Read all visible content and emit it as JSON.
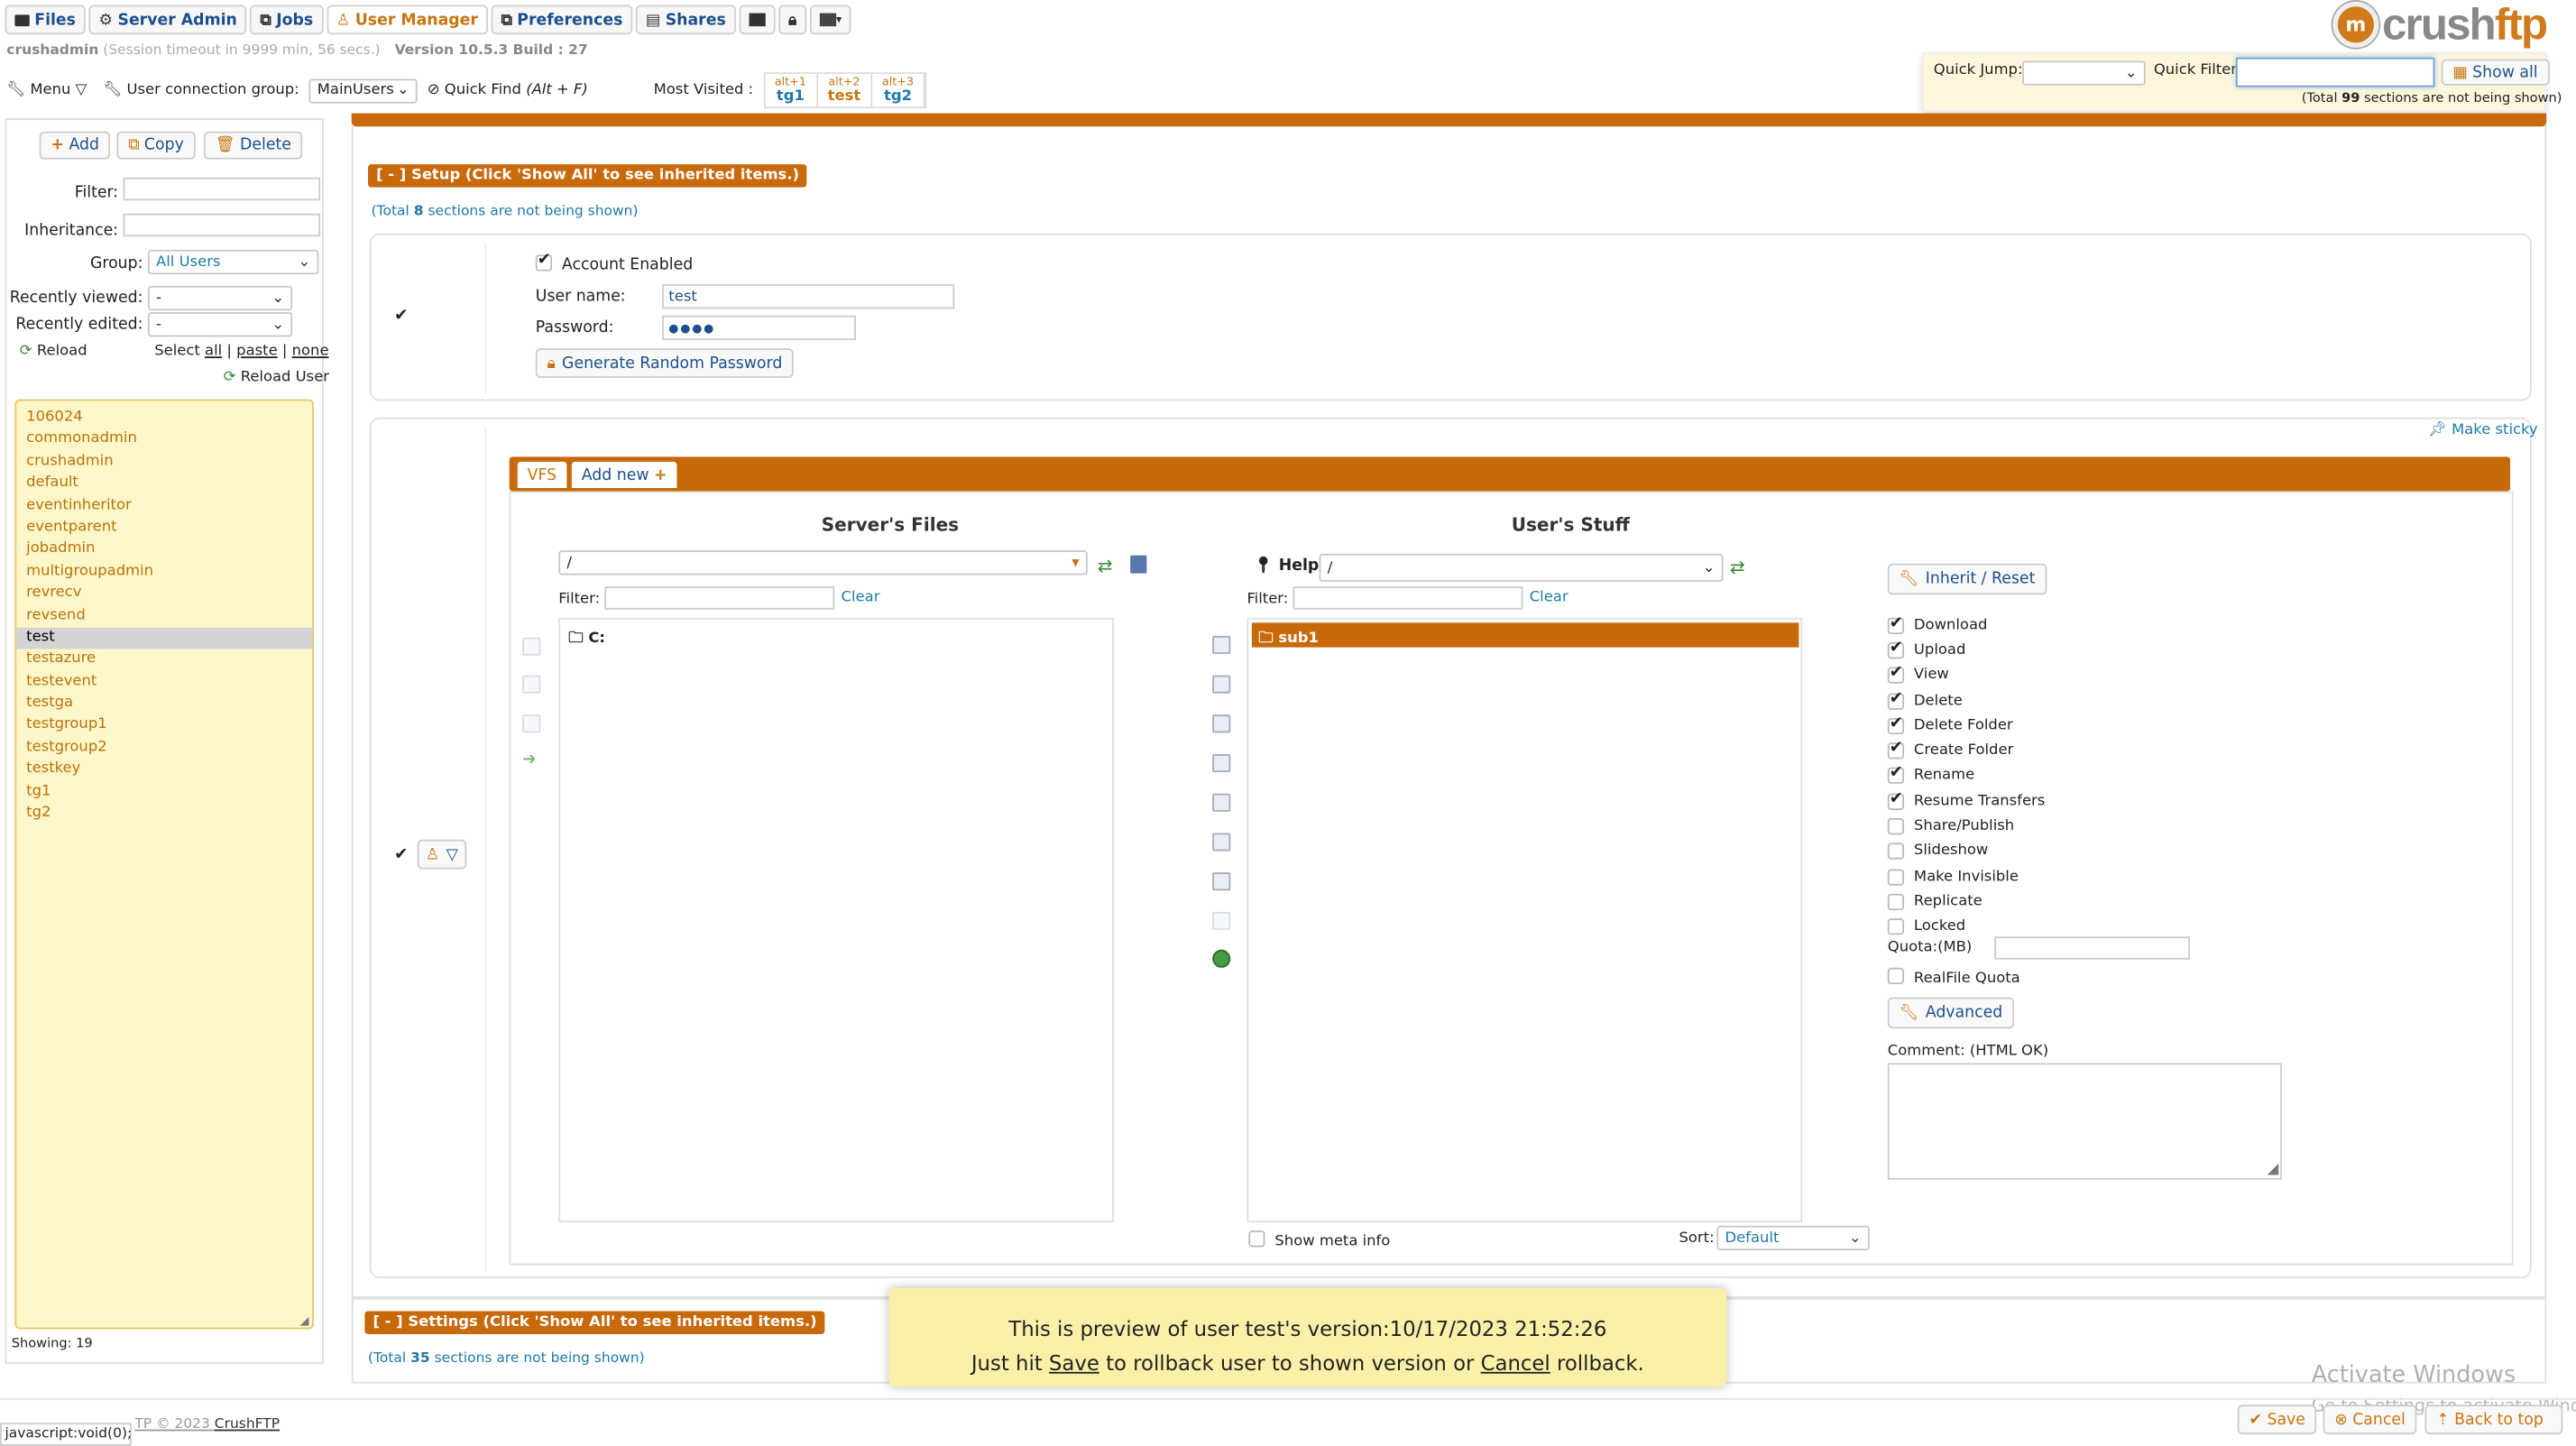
{
  "nav": {
    "tabs": [
      {
        "label": "Files",
        "icon": "folder-icon"
      },
      {
        "label": "Server Admin",
        "icon": "gear-icon"
      },
      {
        "label": "Jobs",
        "icon": "jobs-icon"
      },
      {
        "label": "User Manager",
        "icon": "user-icon"
      },
      {
        "label": "Preferences",
        "icon": "preferences-icon"
      },
      {
        "label": "Shares",
        "icon": "shares-icon"
      }
    ]
  },
  "session": {
    "user": "crushadmin",
    "timeout": "(Session timeout in 9999 min, 56 secs.)",
    "version": "Version 10.5.3 Build : 27"
  },
  "toolbar": {
    "menu_label": "Menu",
    "connection_group_label": "User connection group:",
    "connection_group_value": "MainUsers",
    "quick_find_label": "Quick Find",
    "quick_find_shortcut": "(Alt + F)",
    "most_visited_label": "Most Visited :",
    "most_visited": [
      {
        "key": "alt+1",
        "name": "tg1"
      },
      {
        "key": "alt+2",
        "name": "test"
      },
      {
        "key": "alt+3",
        "name": "tg2"
      }
    ]
  },
  "logo": {
    "text_a": "crush",
    "text_b": "ftp"
  },
  "quickjump": {
    "jump_label": "Quick Jump:",
    "filter_label": "Quick Filter",
    "show_all": "Show all",
    "total_pre": "(Total ",
    "total_num": "99",
    "total_post": " sections are not being shown)"
  },
  "sidebar": {
    "add": "Add",
    "copy": "Copy",
    "delete": "Delete",
    "filter_label": "Filter:",
    "inheritance_label": "Inheritance:",
    "group_label": "Group:",
    "group_value": "All Users",
    "recently_viewed_label": "Recently viewed:",
    "recently_viewed_value": "-",
    "recently_edited_label": "Recently edited:",
    "recently_edited_value": "-",
    "reload": "Reload",
    "select_label": "Select",
    "select_all": "all",
    "paste": "paste",
    "none": "none",
    "reload_user": "Reload User",
    "users": [
      "106024",
      "commonadmin",
      "crushadmin",
      "default",
      "eventinheritor",
      "eventparent",
      "jobadmin",
      "multigroupadmin",
      "revrecv",
      "revsend",
      "test",
      "testazure",
      "testevent",
      "testga",
      "testgroup1",
      "testgroup2",
      "testkey",
      "tg1",
      "tg2"
    ],
    "selected_user": "test",
    "showing": "Showing:  19"
  },
  "setup": {
    "header": "[ - ] Setup (Click 'Show All' to see inherited items.)",
    "total_pre": "(Total ",
    "total_num": "8",
    "total_post": " sections are not being shown)",
    "account_enabled": "Account Enabled",
    "username_label": "User name:",
    "username_value": "test",
    "password_label": "Password:",
    "password_value": "●●●●",
    "generate_password": "Generate Random Password"
  },
  "vfs": {
    "make_sticky": "Make sticky",
    "tab_vfs": "VFS",
    "tab_add_new": "Add new",
    "server_files_title": "Server's Files",
    "server_path": "/",
    "filter_label": "Filter:",
    "clear": "Clear",
    "server_items": [
      "C:"
    ],
    "users_stuff_title": "User's Stuff",
    "help": "Help",
    "user_path": "/",
    "user_items": [
      "sub1"
    ],
    "show_meta": "Show meta info",
    "sort_label": "Sort:",
    "sort_value": "Default",
    "inherit_reset": "Inherit / Reset",
    "permissions": [
      {
        "label": "Download",
        "on": true
      },
      {
        "label": "Upload",
        "on": true
      },
      {
        "label": "View",
        "on": true
      },
      {
        "label": "Delete",
        "on": true
      },
      {
        "label": "Delete Folder",
        "on": true
      },
      {
        "label": "Create Folder",
        "on": true
      },
      {
        "label": "Rename",
        "on": true
      },
      {
        "label": "Resume Transfers",
        "on": true
      },
      {
        "label": "Share/Publish",
        "on": false
      },
      {
        "label": "Slideshow",
        "on": false
      },
      {
        "label": "Make Invisible",
        "on": false
      },
      {
        "label": "Replicate",
        "on": false
      },
      {
        "label": "Locked",
        "on": false
      }
    ],
    "quota_label": "Quota:(MB)",
    "realfile_quota": "RealFile Quota",
    "advanced": "Advanced",
    "comment_label": "Comment: (HTML OK)"
  },
  "settings": {
    "header": "[ - ] Settings (Click 'Show All' to see inherited items.)",
    "total_pre": "(Total ",
    "total_num": "35",
    "total_post": " sections are not being shown)"
  },
  "toast": {
    "line1": "This is preview of user test's version:10/17/2023 21:52:26",
    "pre": "Just hit ",
    "save": "Save",
    "mid": " to rollback user to shown version or ",
    "cancel": "Cancel",
    "post": " rollback."
  },
  "footer": {
    "status": "javascript:void(0);",
    "copyright": "TP © 2023 ",
    "crushftp": "CrushFTP",
    "save": "Save",
    "cancel": "Cancel",
    "back_to_top": "Back to top"
  },
  "watermark": {
    "line1": "Activate Windows",
    "line2": "Go to Settings to activate Windows."
  },
  "colors": {
    "accent": "#c8690c",
    "link": "#1d7aa8",
    "user_list_bg": "#fdf6c8"
  }
}
